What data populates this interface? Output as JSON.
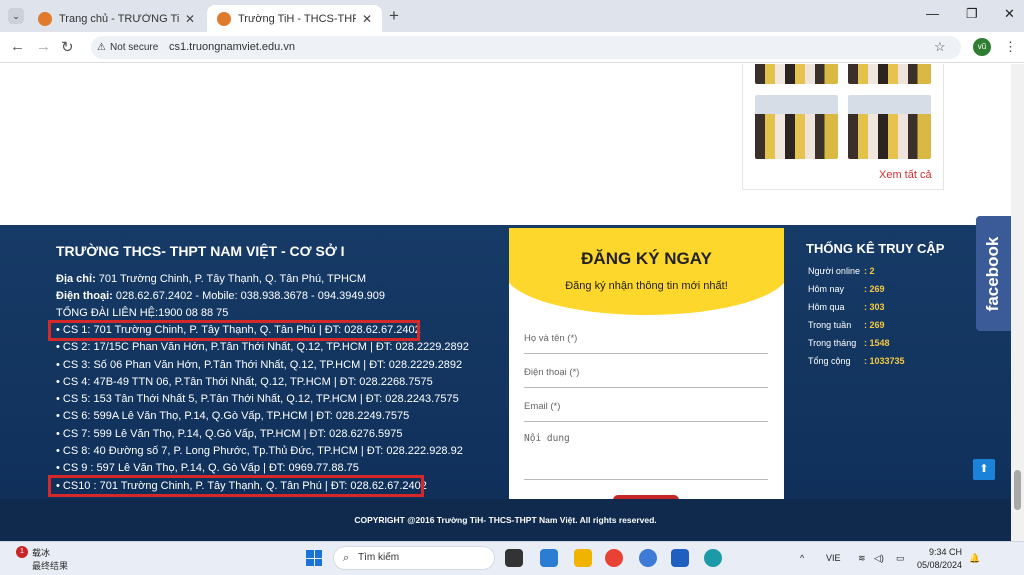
{
  "browser": {
    "tabs": [
      {
        "title": "Trang chủ - TRƯỜNG TiH- THCS",
        "active": false
      },
      {
        "title": "Trường TiH - THCS-THPT Nam V",
        "active": true
      }
    ],
    "new_tab": "+",
    "security_label": "Not secure",
    "url": "cs1.truongnamviet.edu.vn",
    "profile_initials": "vũ"
  },
  "gallery": {
    "see_all": "Xem tất cả"
  },
  "footer": {
    "school_title": "TRƯỜNG THCS- THPT NAM VIỆT - CƠ SỞ I",
    "address_label": "Địa chỉ:",
    "address": " 701 Trường Chinh, P. Tây Thạnh, Q. Tân Phú, TPHCM",
    "phone_label": "Điện thoại:",
    "phone": " 028.62.67.2402 - Mobile: 038.938.3678 - 094.3949.909",
    "hotline": "TỔNG ĐÀI LIÊN HỆ:1900 08 88 75",
    "campuses": [
      "• CS 1: 701 Trường Chinh, P. Tây Thạnh, Q. Tân Phú | ĐT: 028.62.67.2402",
      "• CS 2: 17/15C Phan Văn Hớn, P.Tân Thới Nhất, Q.12, TP.HCM | ĐT: 028.2229.2892",
      "• CS 3: Số 06 Phan Văn Hớn, P.Tân Thới Nhất, Q.12, TP.HCM | ĐT: 028.2229.2892",
      "• CS 4: 47B-49 TTN 06, P.Tân Thới Nhất, Q.12, TP.HCM | ĐT: 028.2268.7575",
      "• CS 5: 153 Tân Thới Nhất 5, P.Tân Thới Nhất, Q.12, TP.HCM | ĐT: 028.2243.7575",
      "• CS 6: 599A Lê Văn Thọ, P.14, Q.Gò Vấp, TP.HCM | ĐT: 028.2249.7575",
      "• CS 7: 599 Lê Văn Thọ, P.14, Q.Gò Vấp, TP.HCM | ĐT: 028.6276.5975",
      "• CS 8: 40 Đường số 7, P. Long Phước, Tp.Thủ Đức, TP.HCM | ĐT: 028.222.928.92",
      "• CS 9 : 597 Lê Văn Thọ, P.14, Q. Gò Vấp | ĐT: 0969.77.88.75",
      "• CS10 : 701 Trường Chinh, P. Tây Thạnh, Q. Tân Phú | ĐT: 028.62.67.2402"
    ],
    "copyright": "COPYRIGHT @2016 Trường TiH- THCS-THPT Nam Việt. All rights reserved."
  },
  "register_form": {
    "title": "ĐĂNG KÝ NGAY",
    "subtitle": "Đăng ký nhận thông tin mới nhất!",
    "name_placeholder": "Họ và tên (*)",
    "phone_placeholder": "Điện thoại (*)",
    "email_placeholder": "Email (*)",
    "content_placeholder": "Nội dung"
  },
  "stats": {
    "title": "THỐNG KÊ TRUY CẬP",
    "rows": [
      {
        "label": "Người online",
        "value": ": 2"
      },
      {
        "label": "Hôm nay",
        "value": ": 269"
      },
      {
        "label": "Hôm qua",
        "value": ": 303"
      },
      {
        "label": "Trong tuần",
        "value": ": 269"
      },
      {
        "label": "Trong tháng",
        "value": ": 1548"
      },
      {
        "label": "Tổng cộng",
        "value": ": 1033735"
      }
    ]
  },
  "facebook_label": "facebook",
  "taskbar": {
    "weather_title": "载冰",
    "weather_sub": "最终结果",
    "weather_badge": "1",
    "search_placeholder": "Tìm kiếm",
    "language": "VIE",
    "time": "9:34 CH",
    "date": "05/08/2024"
  }
}
